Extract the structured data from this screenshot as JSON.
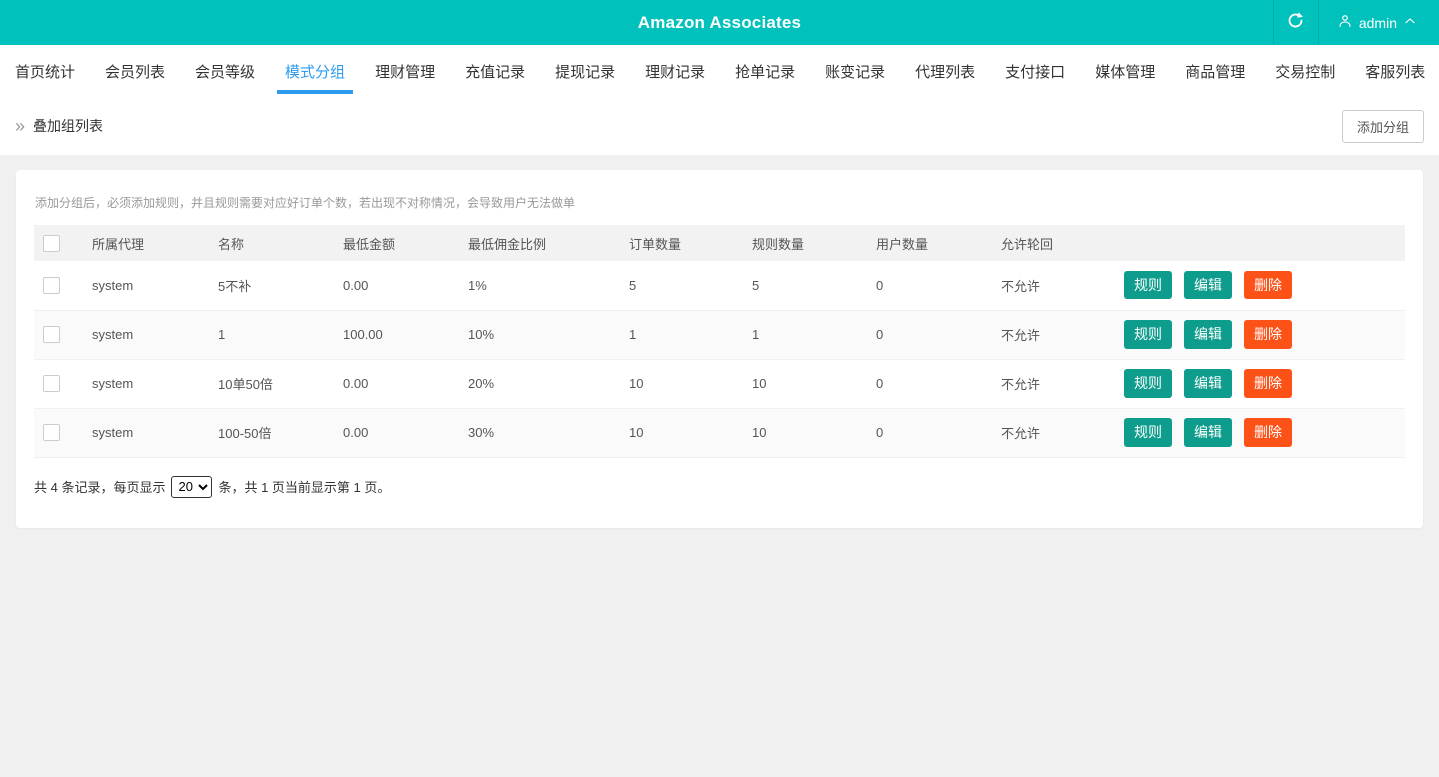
{
  "colors": {
    "topbar_teal": "#00c1bc",
    "active_tab_blue": "#2d9cf0",
    "action_button_teal": "#0e9c8c",
    "delete_button_orange": "#fc5117",
    "page_background": "#f0f0f0"
  },
  "header": {
    "title": "Amazon Associates",
    "user": "admin"
  },
  "nav": {
    "active_index": 3,
    "tabs": [
      {
        "label": "首页统计"
      },
      {
        "label": "会员列表"
      },
      {
        "label": "会员等级"
      },
      {
        "label": "模式分组"
      },
      {
        "label": "理财管理"
      },
      {
        "label": "充值记录"
      },
      {
        "label": "提现记录"
      },
      {
        "label": "理财记录"
      },
      {
        "label": "抢单记录"
      },
      {
        "label": "账变记录"
      },
      {
        "label": "代理列表"
      },
      {
        "label": "支付接口"
      },
      {
        "label": "媒体管理"
      },
      {
        "label": "商品管理"
      },
      {
        "label": "交易控制"
      },
      {
        "label": "客服列表"
      }
    ]
  },
  "breadcrumb": {
    "icon": "»",
    "title": "叠加组列表",
    "add_button_label": "添加分组"
  },
  "main": {
    "notice": "添加分组后，必须添加规则，并且规则需要对应好订单个数，若出现不对称情况，会导致用户无法做单",
    "table": {
      "columns": [
        "所属代理",
        "名称",
        "最低金额",
        "最低佣金比例",
        "订单数量",
        "规则数量",
        "用户数量",
        "允许轮回"
      ],
      "rows": [
        {
          "agent": "system",
          "name": "5不补",
          "min_amount": "0.00",
          "min_commission": "1%",
          "order_count": "5",
          "rule_count": "5",
          "user_count": "0",
          "allow_cycle": "不允许"
        },
        {
          "agent": "system",
          "name": "1",
          "min_amount": "100.00",
          "min_commission": "10%",
          "order_count": "1",
          "rule_count": "1",
          "user_count": "0",
          "allow_cycle": "不允许"
        },
        {
          "agent": "system",
          "name": "10单50倍",
          "min_amount": "0.00",
          "min_commission": "20%",
          "order_count": "10",
          "rule_count": "10",
          "user_count": "0",
          "allow_cycle": "不允许"
        },
        {
          "agent": "system",
          "name": "100-50倍",
          "min_amount": "0.00",
          "min_commission": "30%",
          "order_count": "10",
          "rule_count": "10",
          "user_count": "0",
          "allow_cycle": "不允许"
        }
      ],
      "actions": {
        "rules": "规则",
        "edit": "编辑",
        "delete": "删除"
      }
    },
    "pagination": {
      "prefix": "共 4 条记录，每页显示",
      "page_size": "20",
      "suffix": "条，共 1 页当前显示第 1 页。"
    }
  }
}
